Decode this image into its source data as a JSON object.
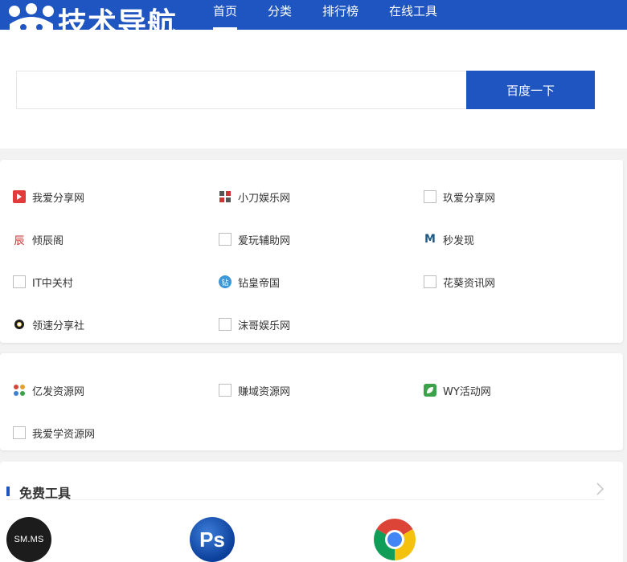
{
  "header": {
    "logo_text": "技术导航",
    "nav": [
      "首页",
      "分类",
      "排行榜",
      "在线工具"
    ]
  },
  "search": {
    "value": "",
    "placeholder": "",
    "button_label": "百度一下"
  },
  "links_group_1": [
    {
      "label": "我爱分享网",
      "icon": "play-icon"
    },
    {
      "label": "小刀娱乐网",
      "icon": "knife-logo-icon"
    },
    {
      "label": "玖爱分享网",
      "icon": "blank-icon"
    },
    {
      "label": "倾辰阁",
      "icon": "chen-icon"
    },
    {
      "label": "爱玩辅助网",
      "icon": "blank-icon"
    },
    {
      "label": "秒发现",
      "icon": "m-logo-icon"
    },
    {
      "label": "IT中关村",
      "icon": "blank-icon"
    },
    {
      "label": "钻皇帝国",
      "icon": "globe-icon"
    },
    {
      "label": "花葵资讯网",
      "icon": "blank-icon"
    },
    {
      "label": "领速分享社",
      "icon": "ring-icon"
    },
    {
      "label": "沫哥娱乐网",
      "icon": "blank-icon"
    }
  ],
  "links_group_2": [
    {
      "label": "亿发资源网",
      "icon": "yifa-logo-icon"
    },
    {
      "label": "赚域资源网",
      "icon": "blank-icon"
    },
    {
      "label": "WY活动网",
      "icon": "leaf-icon"
    },
    {
      "label": "我爱学资源网",
      "icon": "blank-icon"
    }
  ],
  "tools": {
    "title": "免费工具",
    "items": [
      {
        "label": "SM.MS",
        "icon": "smms-icon"
      },
      {
        "label": "Ps",
        "icon": "photoshop-icon"
      },
      {
        "label": "",
        "icon": "chrome-icon"
      }
    ]
  },
  "colors": {
    "primary": "#1f55c0",
    "background": "#f2f2f2"
  }
}
